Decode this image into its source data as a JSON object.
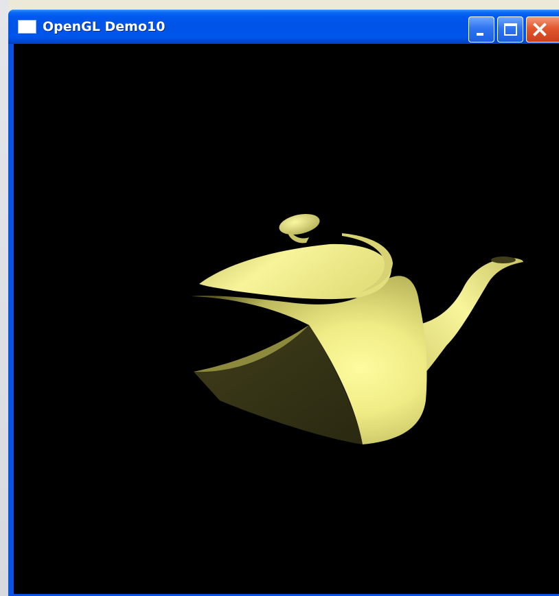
{
  "window": {
    "title": "OpenGL Demo10",
    "icon": "application-window-icon",
    "controls": {
      "minimize_icon": "minimize-icon",
      "maximize_icon": "maximize-icon",
      "close_icon": "close-icon"
    }
  },
  "canvas": {
    "background": "#000000",
    "object": "teapot",
    "object_color": "#f4f08a"
  },
  "colors": {
    "title_bar": "#0054e6",
    "close_button": "#e3582e",
    "caption_buttons": "#2f74f0"
  }
}
